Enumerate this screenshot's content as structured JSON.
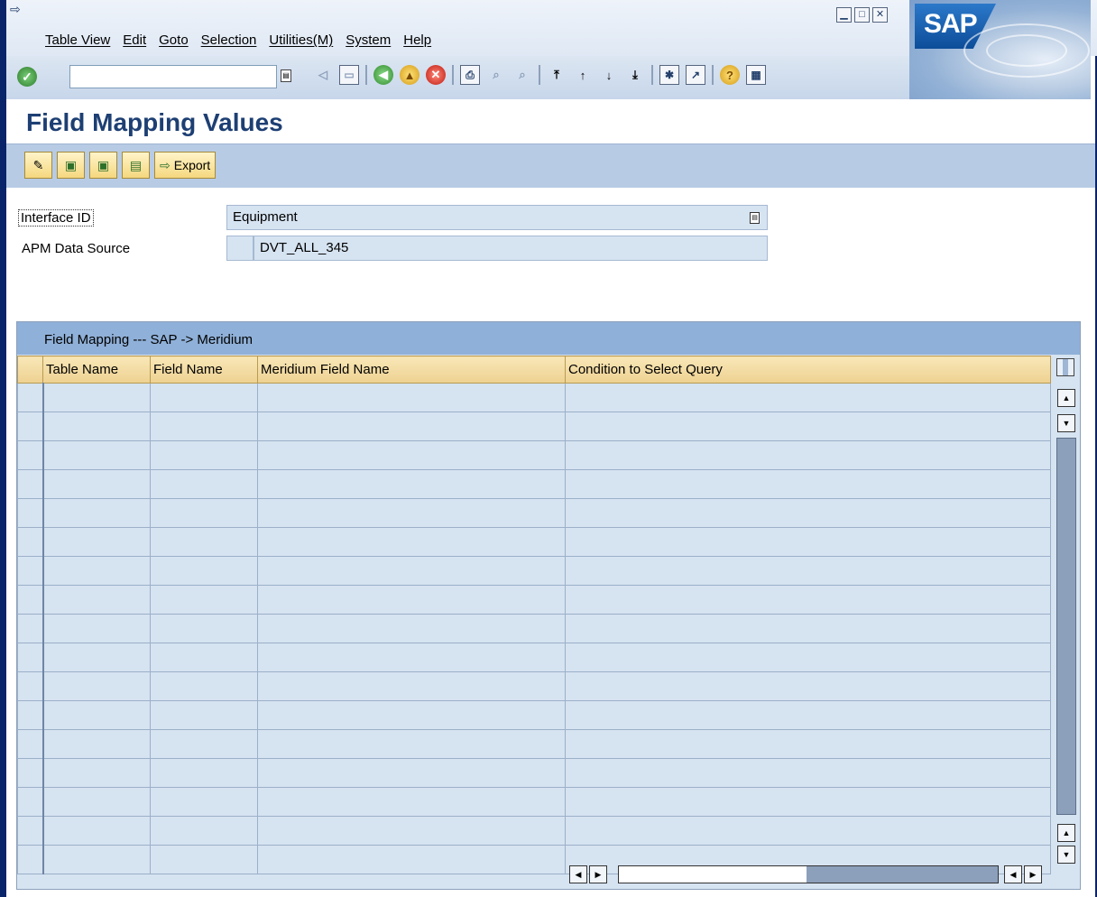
{
  "window": {
    "menu": [
      "Table View",
      "Edit",
      "Goto",
      "Selection",
      "Utilities(M)",
      "System",
      "Help"
    ],
    "brand": "SAP"
  },
  "toolbar": {
    "command_field_value": ""
  },
  "page": {
    "title": "Field Mapping Values"
  },
  "app_toolbar": {
    "export_label": "Export"
  },
  "form": {
    "interface_id_label": "Interface ID",
    "interface_id_value": "Equipment",
    "apm_data_source_label": "APM Data Source",
    "apm_data_source_value": "DVT_ALL_345"
  },
  "table": {
    "title": "Field Mapping --- SAP -> Meridium",
    "columns": [
      "Table Name",
      "Field Name",
      "Meridium Field Name",
      "Condition to Select Query"
    ],
    "rows": 17
  },
  "colors": {
    "frame": "#0a246a",
    "header_bg": "#eed191",
    "cell_bg": "#d6e3f1",
    "title_text": "#1d3f73"
  }
}
